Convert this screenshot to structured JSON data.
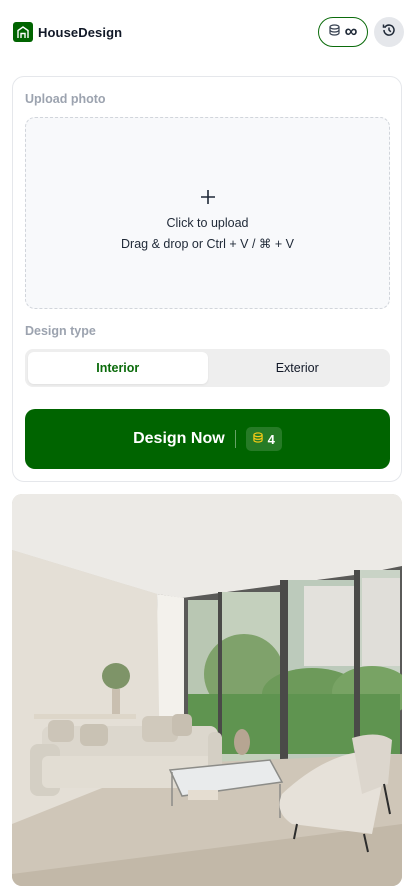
{
  "header": {
    "brand_name": "HouseDesign",
    "logo_icon": "house-icon",
    "credits_icon": "coins-icon",
    "credits_value": "∞",
    "history_icon": "history-icon"
  },
  "upload": {
    "section_label": "Upload photo",
    "plus_icon": "plus-icon",
    "title": "Click to upload",
    "hint": "Drag & drop or Ctrl + V / ⌘ + V"
  },
  "design_type": {
    "section_label": "Design type",
    "options": [
      {
        "label": "Interior",
        "selected": true
      },
      {
        "label": "Exterior",
        "selected": false
      }
    ]
  },
  "action": {
    "design_button_label": "Design Now",
    "cost_icon": "coins-icon",
    "cost_value": "4"
  },
  "preview": {
    "image_icon": "living-room-photo"
  },
  "colors": {
    "brand_green": "#006400",
    "coin_yellow": "#facc15"
  }
}
